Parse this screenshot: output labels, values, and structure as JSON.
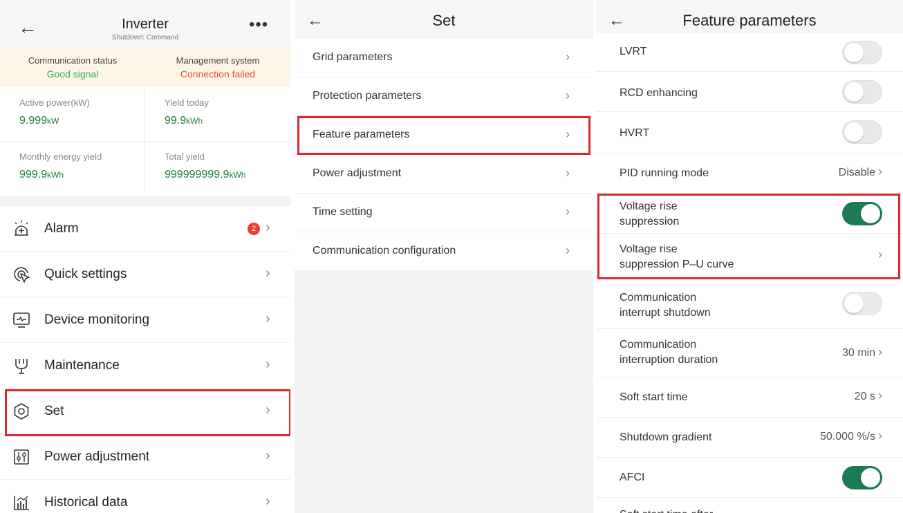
{
  "inverter": {
    "title": "Inverter",
    "subtitle": "Shutdown: Command",
    "comm_status_label": "Communication status",
    "comm_status_value": "Good signal",
    "mgmt_label": "Management system",
    "mgmt_value": "Connection failed",
    "active_power_label": "Active power(kW)",
    "active_power_value": "9.999",
    "active_power_unit": "kW",
    "yield_today_label": "Yield today",
    "yield_today_value": "99.9",
    "yield_today_unit": "kWh",
    "monthly_label": "Monthly energy yield",
    "monthly_value": "999.9",
    "monthly_unit": "kWh",
    "total_label": "Total yield",
    "total_value": "999999999.9",
    "total_unit": "kWh",
    "alarm_count": "2",
    "menu": [
      "Alarm",
      "Quick settings",
      "Device monitoring",
      "Maintenance",
      "Set",
      "Power adjustment",
      "Historical data"
    ]
  },
  "set": {
    "title": "Set",
    "items": [
      "Grid parameters",
      "Protection parameters",
      "Feature parameters",
      "Power adjustment",
      "Time setting",
      "Communication configuration"
    ]
  },
  "feature": {
    "title": "Feature parameters",
    "rows": [
      {
        "label": "LVRT",
        "toggle": "off"
      },
      {
        "label": "RCD enhancing",
        "toggle": "off"
      },
      {
        "label": "HVRT",
        "toggle": "off"
      },
      {
        "label": "PID running mode",
        "value": "Disable"
      },
      {
        "label": "Voltage rise suppression",
        "line1": "Voltage rise",
        "line2": "suppression",
        "toggle": "on"
      },
      {
        "label": "Voltage rise suppression P-U curve",
        "line1": "Voltage rise",
        "line2": "suppression P–U curve"
      },
      {
        "label": "Communication interrupt shutdown",
        "line1": "Communication",
        "line2": "interrupt shutdown",
        "toggle": "off"
      },
      {
        "label": "Communication interruption duration",
        "line1": "Communication",
        "line2": "interruption duration",
        "value": "30 min"
      },
      {
        "label": "Soft start time",
        "value": "20 s"
      },
      {
        "label": "Shutdown gradient",
        "value": "50.000 %/s"
      },
      {
        "label": "AFCI",
        "toggle": "on"
      },
      {
        "label": "Soft start time after"
      }
    ]
  },
  "colors": {
    "highlight": "#e0262c",
    "toggle_on": "#1d7a55",
    "good": "#2bb24c",
    "bad": "#f04a2e",
    "value_green": "#1d7f3a"
  },
  "icons": [
    "back-arrow-icon",
    "more-icon",
    "alarm-icon",
    "quick-settings-icon",
    "device-monitoring-icon",
    "maintenance-icon",
    "set-icon",
    "power-adjustment-icon",
    "historical-data-icon",
    "chevron-right-icon"
  ]
}
